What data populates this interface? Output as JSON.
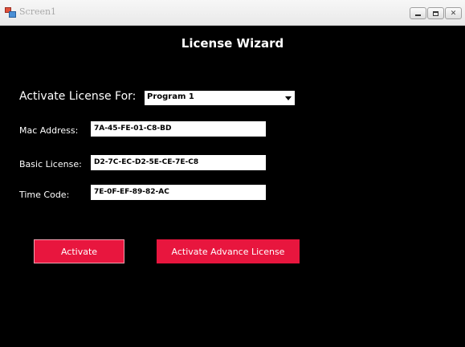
{
  "window": {
    "title": "Screen1",
    "controls": {
      "minimize_icon": "minimize-icon",
      "maximize_icon": "maximize-icon",
      "close_icon": "close-icon"
    }
  },
  "main": {
    "title": "License Wizard",
    "activate_for_label": "Activate License For:",
    "program_select": {
      "value": "Program 1"
    },
    "fields": {
      "mac_label": "Mac Address:",
      "mac_value": "7A-45-FE-01-C8-BD",
      "basic_label": "Basic License:",
      "basic_value": "D2-7C-EC-D2-5E-CE-7E-C8",
      "time_label": "Time Code:",
      "time_value": "7E-0F-EF-89-82-AC"
    },
    "buttons": {
      "activate": "Activate",
      "activate_advance": "Activate Advance License"
    }
  },
  "colors": {
    "background": "#000000",
    "accent": "#e8163e",
    "text": "#ffffff"
  }
}
